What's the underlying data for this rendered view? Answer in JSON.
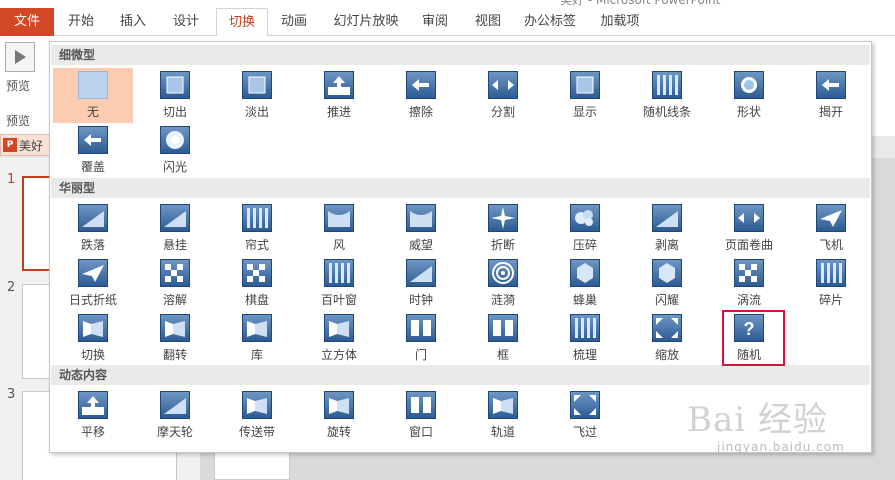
{
  "window": {
    "title_fragment": "美好 - Microsoft PowerPoint"
  },
  "ribbon": {
    "tabs": [
      "文件",
      "开始",
      "插入",
      "设计",
      "切换",
      "动画",
      "幻灯片放映",
      "审阅",
      "视图",
      "办公标签",
      "加载项"
    ],
    "active_tab": "切换"
  },
  "left": {
    "preview_label": "预览",
    "preview_group": "预览",
    "file_tab_name": "美好",
    "file_icon": "P",
    "slide_numbers": [
      "1",
      "2",
      "3"
    ]
  },
  "gallery": {
    "sections": [
      {
        "title": "细微型",
        "items": [
          {
            "label": "无",
            "icon": "none-icon",
            "glyph": "blank"
          },
          {
            "label": "切出",
            "icon": "cut-icon",
            "glyph": "square"
          },
          {
            "label": "淡出",
            "icon": "fade-icon",
            "glyph": "square"
          },
          {
            "label": "推进",
            "icon": "push-icon",
            "glyph": "up"
          },
          {
            "label": "擦除",
            "icon": "wipe-icon",
            "glyph": "left"
          },
          {
            "label": "分割",
            "icon": "split-icon",
            "glyph": "split"
          },
          {
            "label": "显示",
            "icon": "reveal-icon",
            "glyph": "square"
          },
          {
            "label": "随机线条",
            "icon": "random-bars-icon",
            "glyph": "bars"
          },
          {
            "label": "形状",
            "icon": "shape-icon",
            "glyph": "circle"
          },
          {
            "label": "揭开",
            "icon": "uncover-icon",
            "glyph": "left"
          },
          {
            "label": "覆盖",
            "icon": "cover-icon",
            "glyph": "left"
          },
          {
            "label": "闪光",
            "icon": "flash-icon",
            "glyph": "flash"
          }
        ]
      },
      {
        "title": "华丽型",
        "items": [
          {
            "label": "跌落",
            "icon": "fall-over-icon",
            "glyph": "tri"
          },
          {
            "label": "悬挂",
            "icon": "drape-icon",
            "glyph": "tri"
          },
          {
            "label": "帘式",
            "icon": "curtains-icon",
            "glyph": "bars"
          },
          {
            "label": "风",
            "icon": "wind-icon",
            "glyph": "wave"
          },
          {
            "label": "威望",
            "icon": "prestige-icon",
            "glyph": "wave"
          },
          {
            "label": "折断",
            "icon": "fracture-icon",
            "glyph": "star"
          },
          {
            "label": "压碎",
            "icon": "crush-icon",
            "glyph": "blob"
          },
          {
            "label": "剥离",
            "icon": "peel-off-icon",
            "glyph": "tri"
          },
          {
            "label": "页面卷曲",
            "icon": "page-curl-icon",
            "glyph": "split"
          },
          {
            "label": "飞机",
            "icon": "airplane-icon",
            "glyph": "plane"
          },
          {
            "label": "日式折纸",
            "icon": "origami-icon",
            "glyph": "plane"
          },
          {
            "label": "溶解",
            "icon": "dissolve-icon",
            "glyph": "grid"
          },
          {
            "label": "棋盘",
            "icon": "checkerboard-icon",
            "glyph": "grid"
          },
          {
            "label": "百叶窗",
            "icon": "blinds-icon",
            "glyph": "bars"
          },
          {
            "label": "时钟",
            "icon": "clock-icon",
            "glyph": "tri"
          },
          {
            "label": "涟漪",
            "icon": "ripple-icon",
            "glyph": "rings"
          },
          {
            "label": "蜂巢",
            "icon": "honeycomb-icon",
            "glyph": "hex"
          },
          {
            "label": "闪耀",
            "icon": "glitter-icon",
            "glyph": "hex"
          },
          {
            "label": "涡流",
            "icon": "vortex-icon",
            "glyph": "grid"
          },
          {
            "label": "碎片",
            "icon": "shred-icon",
            "glyph": "bars"
          },
          {
            "label": "切换",
            "icon": "switch-icon",
            "glyph": "box3d"
          },
          {
            "label": "翻转",
            "icon": "flip-icon",
            "glyph": "box3d"
          },
          {
            "label": "库",
            "icon": "gallery-icon",
            "glyph": "box3d"
          },
          {
            "label": "立方体",
            "icon": "cube-icon",
            "glyph": "box3d"
          },
          {
            "label": "门",
            "icon": "doors-icon",
            "glyph": "doors"
          },
          {
            "label": "框",
            "icon": "box-icon",
            "glyph": "doors"
          },
          {
            "label": "梳理",
            "icon": "comb-icon",
            "glyph": "bars"
          },
          {
            "label": "缩放",
            "icon": "zoom-icon",
            "glyph": "arrows"
          },
          {
            "label": "随机",
            "icon": "random-icon",
            "glyph": "question"
          }
        ]
      },
      {
        "title": "动态内容",
        "items": [
          {
            "label": "平移",
            "icon": "pan-icon",
            "glyph": "up"
          },
          {
            "label": "摩天轮",
            "icon": "ferris-wheel-icon",
            "glyph": "tri"
          },
          {
            "label": "传送带",
            "icon": "conveyor-icon",
            "glyph": "box3d"
          },
          {
            "label": "旋转",
            "icon": "rotate-icon",
            "glyph": "box3d"
          },
          {
            "label": "窗口",
            "icon": "window-icon",
            "glyph": "doors"
          },
          {
            "label": "轨道",
            "icon": "orbit-icon",
            "glyph": "box3d"
          },
          {
            "label": "飞过",
            "icon": "fly-through-icon",
            "glyph": "arrows"
          }
        ]
      }
    ],
    "selected_item": "无",
    "highlighted_item": "随机"
  },
  "watermark": {
    "text": "Bai 经验",
    "sub": "jingyan.baidu.com"
  }
}
